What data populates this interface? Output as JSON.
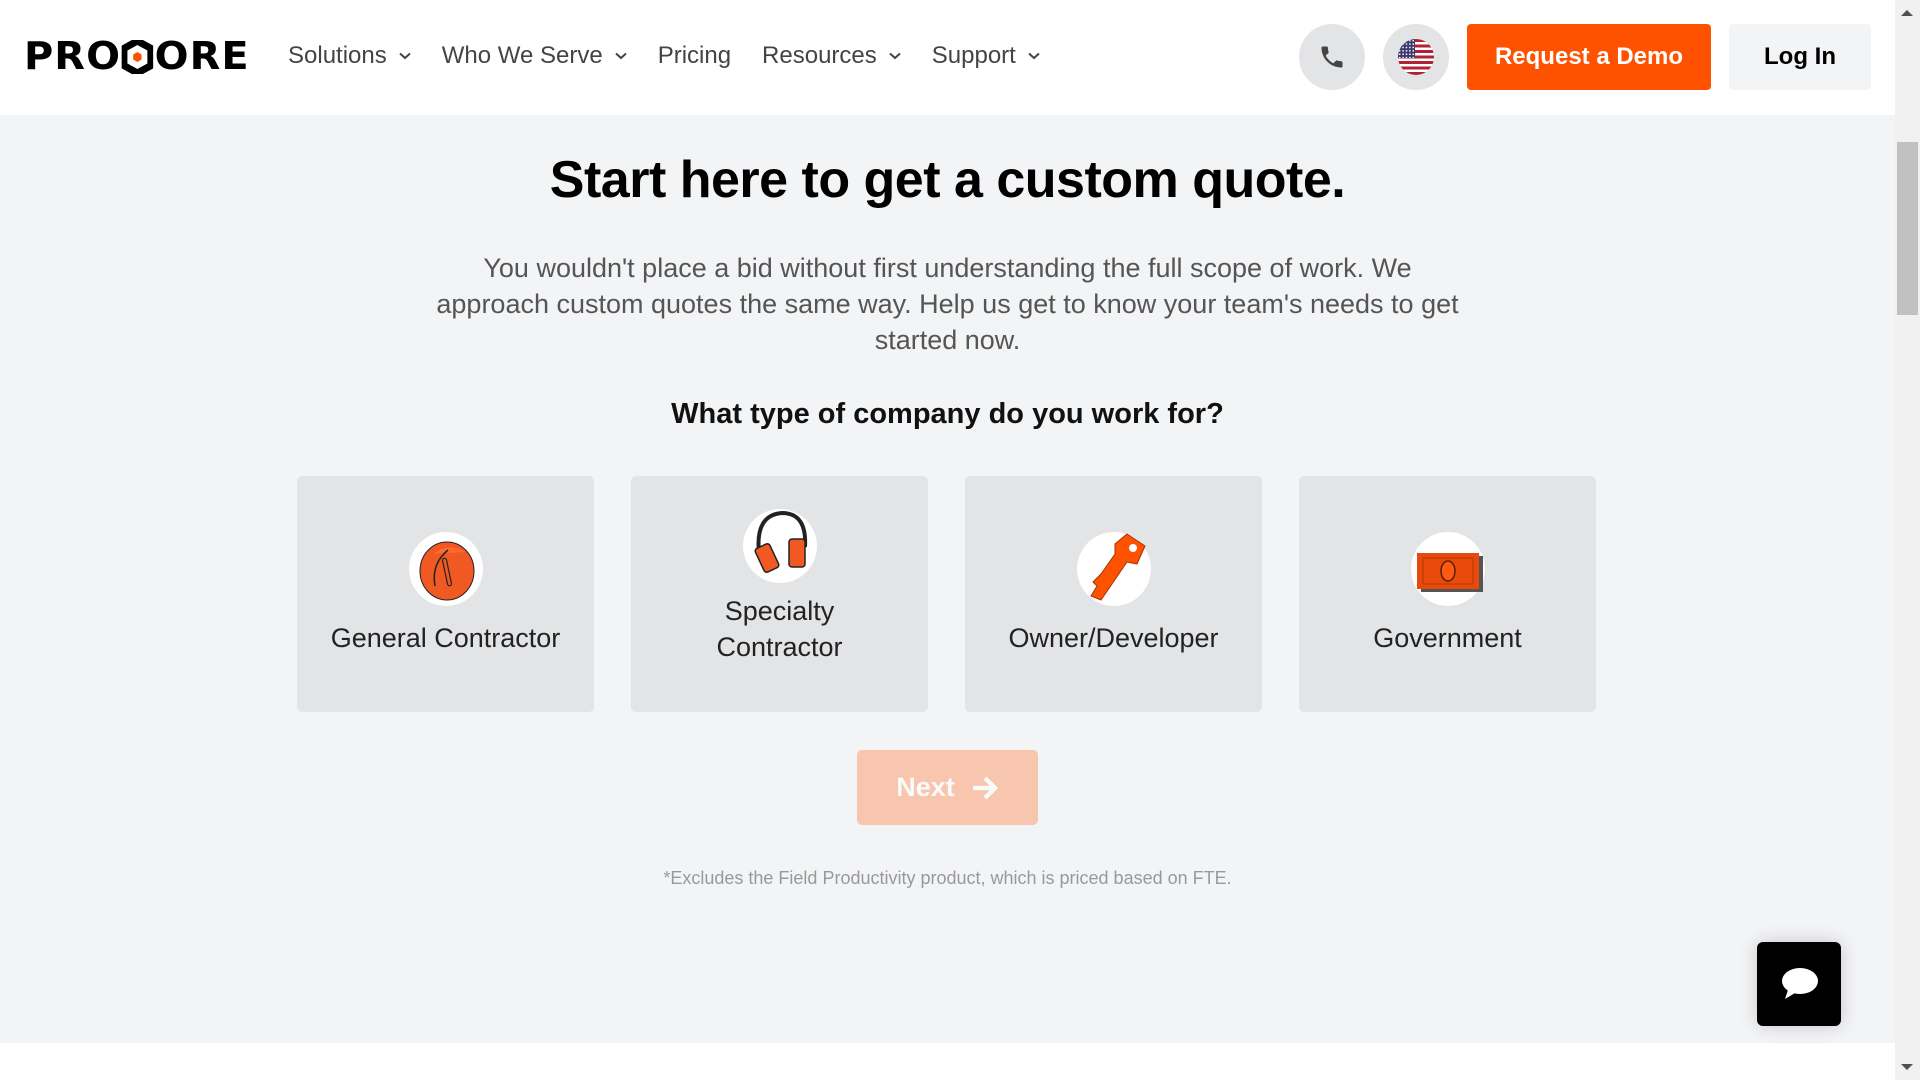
{
  "header": {
    "logo_text": [
      "PRO",
      "C",
      "ORE"
    ],
    "nav": [
      {
        "label": "Solutions",
        "has_dropdown": true
      },
      {
        "label": "Who We Serve",
        "has_dropdown": true
      },
      {
        "label": "Pricing",
        "has_dropdown": false
      },
      {
        "label": "Resources",
        "has_dropdown": true
      },
      {
        "label": "Support",
        "has_dropdown": true
      }
    ],
    "phone_icon": "phone-icon",
    "locale_icon": "us-flag-icon",
    "request_demo_label": "Request a Demo",
    "login_label": "Log In"
  },
  "main": {
    "title": "Start here to get a custom quote.",
    "intro": "You wouldn't place a bid without first understanding the full scope of work. We approach custom quotes the same way. Help us get to know your team's needs to get started now.",
    "question": "What type of company do you work for?",
    "options": [
      {
        "label": "General Contractor",
        "icon": "hard-hat-icon"
      },
      {
        "label": "Specialty Contractor",
        "icon": "ear-muffs-icon"
      },
      {
        "label": "Owner/Developer",
        "icon": "key-icon"
      },
      {
        "label": "Government",
        "icon": "dollar-bill-icon"
      }
    ],
    "next_label": "Next",
    "next_disabled": true,
    "footnote": "*Excludes the Field Productivity product, which is priced based on FTE."
  },
  "chat": {
    "icon": "chat-bubble-icon"
  },
  "colors": {
    "brand_orange": "#ff5200",
    "next_disabled": "#f8c5ae",
    "page_bg": "#f3f4f6",
    "card_bg": "#e3e4e6"
  }
}
